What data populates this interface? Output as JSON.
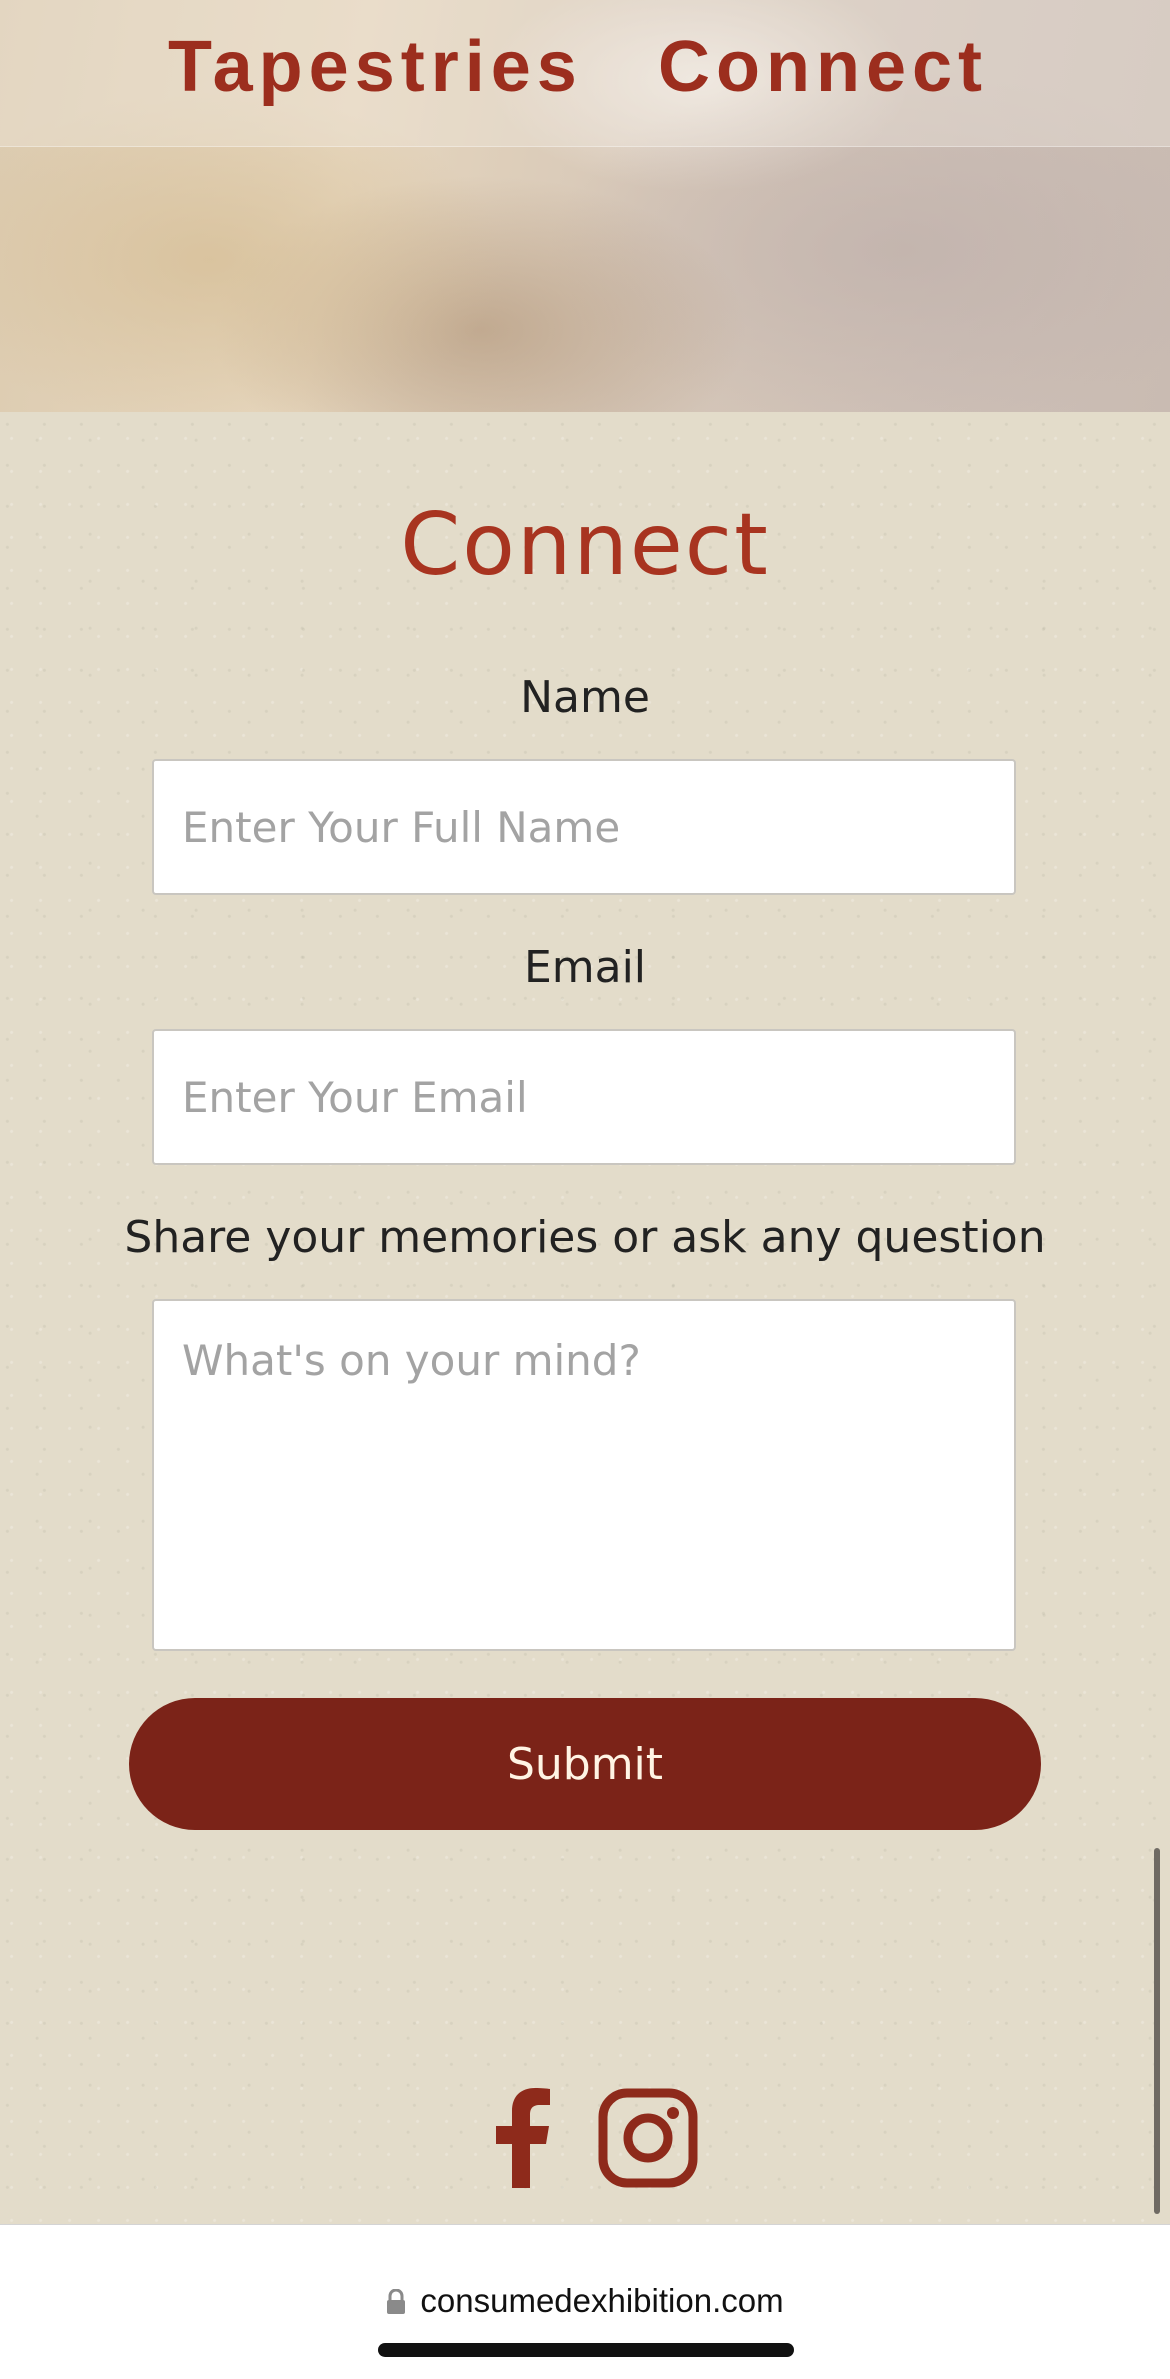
{
  "nav": {
    "items": [
      {
        "label": "Tapestries"
      },
      {
        "label": "Connect"
      }
    ]
  },
  "main": {
    "title": "Connect",
    "form": {
      "name": {
        "label": "Name",
        "placeholder": "Enter Your Full Name"
      },
      "email": {
        "label": "Email",
        "placeholder": "Enter Your Email"
      },
      "message": {
        "label": "Share your memories or ask any question",
        "placeholder": "What's on your mind?"
      },
      "submit_label": "Submit"
    }
  },
  "social": [
    {
      "icon": "facebook-icon"
    },
    {
      "icon": "instagram-icon"
    }
  ],
  "browser": {
    "url": "consumedexhibition.com"
  },
  "colors": {
    "accent": "#a83420",
    "button": "#7b2318",
    "background": "#e3dcca"
  }
}
